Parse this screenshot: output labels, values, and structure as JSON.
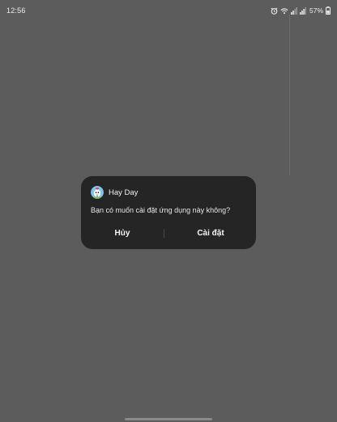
{
  "status_bar": {
    "time": "12:56",
    "battery_percent": "57%",
    "icons": [
      "alarm-icon",
      "wifi-icon",
      "signal-icon",
      "signal-icon",
      "battery-icon"
    ]
  },
  "dialog": {
    "app_name": "Hay Day",
    "app_icon": "hay-day-app-icon",
    "message": "Bạn có muốn cài đặt ứng dụng này không?",
    "cancel_label": "Hủy",
    "install_label": "Cài đặt"
  },
  "colors": {
    "background": "#5c5c5c",
    "dialog": "#252525",
    "text": "#f2f2f2"
  }
}
